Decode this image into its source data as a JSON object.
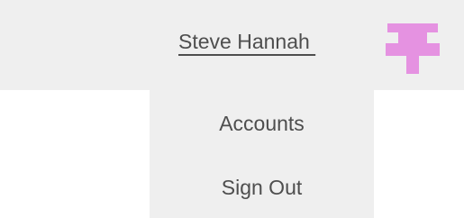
{
  "header": {
    "user_name": "Steve Hannah ",
    "avatar_icon": "pushpin-avatar-icon",
    "avatar_color": "#e592e1"
  },
  "menu": {
    "items": [
      {
        "label": "Accounts"
      },
      {
        "label": "Sign Out"
      }
    ]
  },
  "colors": {
    "bar_background": "#efefef",
    "text": "#4e4e4e"
  }
}
